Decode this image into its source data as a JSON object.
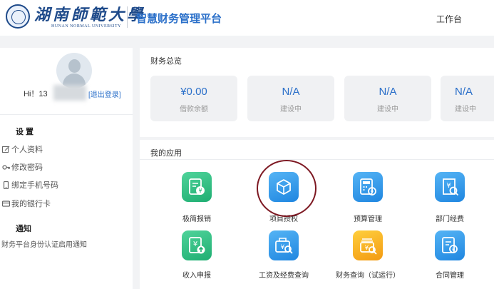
{
  "header": {
    "logo_cn": "湖南師範大學",
    "logo_en": "HUNAN NORMAL UNIVERSITY",
    "platform_title": "智慧财务管理平台",
    "nav_workbench": "工作台"
  },
  "user": {
    "greeting": "Hi！13",
    "logout": "[退出登录]"
  },
  "settings": {
    "title": "设 置",
    "items": [
      {
        "label": "个人资料",
        "icon": "edit-icon"
      },
      {
        "label": "修改密码",
        "icon": "key-icon"
      },
      {
        "label": "绑定手机号码",
        "icon": "phone-icon"
      },
      {
        "label": "我的银行卡",
        "icon": "bank-card-icon"
      }
    ]
  },
  "notice": {
    "title": "通知",
    "text": "财务平台身份认证启用通知"
  },
  "finance": {
    "title": "财务总览",
    "cards": [
      {
        "value": "¥0.00",
        "label": "借款余额"
      },
      {
        "value": "N/A",
        "label": "建设中"
      },
      {
        "value": "N/A",
        "label": "建设中"
      },
      {
        "value": "N/A",
        "label": "建设中"
      }
    ]
  },
  "apps": {
    "title": "我的应用",
    "items": [
      {
        "label": "极简报销",
        "icon": "reimbursement-icon",
        "color": "#2bbd7e"
      },
      {
        "label": "项目授权",
        "icon": "cube-icon",
        "color": "#2b8ee8"
      },
      {
        "label": "预算管理",
        "icon": "budget-calculator-icon",
        "color": "#2b8ee8"
      },
      {
        "label": "部门经费",
        "icon": "department-funds-icon",
        "color": "#2b8ee8"
      },
      {
        "label": "收入申报",
        "icon": "income-report-icon",
        "color": "#2bbd7e"
      },
      {
        "label": "工资及经费查询",
        "icon": "salary-query-icon",
        "color": "#2b8ee8"
      },
      {
        "label": "财务查询（试运行）",
        "icon": "finance-query-icon",
        "color": "#f5a623"
      },
      {
        "label": "合同管理",
        "icon": "contract-icon",
        "color": "#2b8ee8"
      }
    ]
  }
}
